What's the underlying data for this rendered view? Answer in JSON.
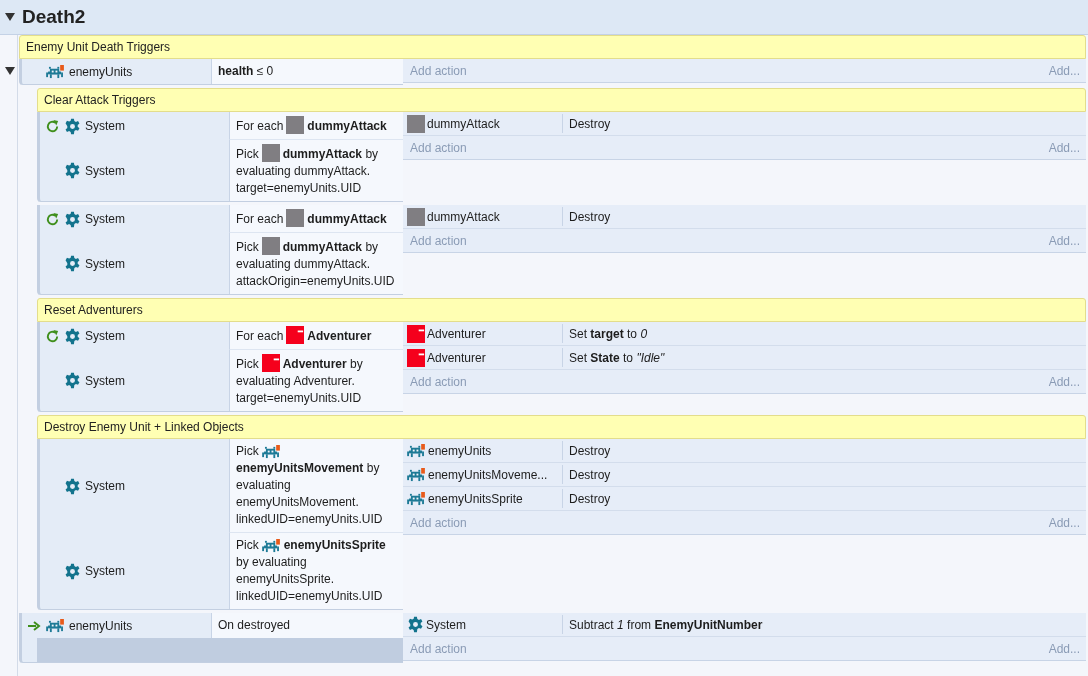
{
  "sheet": {
    "title": "Death2",
    "expanded": true
  },
  "items": [
    {
      "kind": "group",
      "title": "Enemy Unit Death Triggers",
      "items": [
        {
          "kind": "event",
          "expanded": true,
          "conditions": [
            {
              "loop": false,
              "trigger": false,
              "object": {
                "kind": "invader",
                "name": "enemyUnits"
              },
              "text": "**health** ≤ 0"
            }
          ],
          "add_action": "Add action",
          "add_more": "Add...",
          "children": [
            {
              "kind": "group",
              "title": "Clear Attack Triggers",
              "items": [
                {
                  "kind": "event",
                  "conditions": [
                    {
                      "loop": true,
                      "trigger": false,
                      "object": {
                        "kind": "system",
                        "name": "System"
                      },
                      "lead": "For each",
                      "target": {
                        "kind": "plain",
                        "name": "dummyAttack"
                      }
                    },
                    {
                      "loop": false,
                      "trigger": false,
                      "object": {
                        "kind": "system",
                        "name": "System"
                      },
                      "lead": "Pick",
                      "target": {
                        "kind": "plain",
                        "name": "dummyAttack"
                      },
                      "text": "by evaluating dummyAttack.target=enemyUnits.UID"
                    }
                  ],
                  "actions": [
                    {
                      "object": {
                        "kind": "plain",
                        "name": "dummyAttack"
                      },
                      "text": "Destroy"
                    }
                  ],
                  "add_action": "Add action",
                  "add_more": "Add..."
                },
                {
                  "kind": "event",
                  "conditions": [
                    {
                      "loop": true,
                      "trigger": false,
                      "object": {
                        "kind": "system",
                        "name": "System"
                      },
                      "lead": "For each",
                      "target": {
                        "kind": "plain",
                        "name": "dummyAttack"
                      }
                    },
                    {
                      "loop": false,
                      "trigger": false,
                      "object": {
                        "kind": "system",
                        "name": "System"
                      },
                      "lead": "Pick",
                      "target": {
                        "kind": "plain",
                        "name": "dummyAttack"
                      },
                      "text": "by evaluating dummyAttack.attackOrigin=enemyUnits.UID"
                    }
                  ],
                  "actions": [
                    {
                      "object": {
                        "kind": "plain",
                        "name": "dummyAttack"
                      },
                      "text": "Destroy"
                    }
                  ],
                  "add_action": "Add action",
                  "add_more": "Add..."
                }
              ]
            },
            {
              "kind": "group",
              "title": "Reset Adventurers",
              "items": [
                {
                  "kind": "event",
                  "conditions": [
                    {
                      "loop": true,
                      "trigger": false,
                      "object": {
                        "kind": "system",
                        "name": "System"
                      },
                      "lead": "For each",
                      "target": {
                        "kind": "flagged",
                        "name": "Adventurer"
                      }
                    },
                    {
                      "loop": false,
                      "trigger": false,
                      "object": {
                        "kind": "system",
                        "name": "System"
                      },
                      "lead": "Pick",
                      "target": {
                        "kind": "flagged",
                        "name": "Adventurer"
                      },
                      "text": "by evaluating Adventurer.target=enemyUnits.UID"
                    }
                  ],
                  "actions": [
                    {
                      "object": {
                        "kind": "flagged",
                        "name": "Adventurer"
                      },
                      "text": "Set **target** to *0*"
                    },
                    {
                      "object": {
                        "kind": "flagged",
                        "name": "Adventurer"
                      },
                      "text": "Set **State** to *\"Idle\"*"
                    }
                  ],
                  "add_action": "Add action",
                  "add_more": "Add..."
                }
              ]
            },
            {
              "kind": "group",
              "title": "Destroy Enemy Unit + Linked Objects",
              "items": [
                {
                  "kind": "event",
                  "conditions": [
                    {
                      "loop": false,
                      "trigger": false,
                      "object": {
                        "kind": "system",
                        "name": "System"
                      },
                      "lead": "Pick",
                      "target": {
                        "kind": "invader",
                        "name": "enemyUnitsMovement"
                      },
                      "text": "by evaluating enemyUnitsMovement.linkedUID=enemyUnits.UID"
                    },
                    {
                      "loop": false,
                      "trigger": false,
                      "object": {
                        "kind": "system",
                        "name": "System"
                      },
                      "lead": "Pick",
                      "target": {
                        "kind": "invader",
                        "name": "enemyUnitsSprite"
                      },
                      "text": "by evaluating enemyUnitsSprite.linkedUID=enemyUnits.UID"
                    }
                  ],
                  "actions": [
                    {
                      "object": {
                        "kind": "invader",
                        "name": "enemyUnits"
                      },
                      "text": "Destroy"
                    },
                    {
                      "object": {
                        "kind": "invader",
                        "name": "enemyUnitsMoveme..."
                      },
                      "text": "Destroy"
                    },
                    {
                      "object": {
                        "kind": "invader",
                        "name": "enemyUnitsSprite"
                      },
                      "text": "Destroy"
                    }
                  ],
                  "add_action": "Add action",
                  "add_more": "Add..."
                }
              ]
            }
          ]
        },
        {
          "kind": "event",
          "conditions": [
            {
              "loop": false,
              "trigger": true,
              "object": {
                "kind": "invader",
                "name": "enemyUnits"
              },
              "text": "On destroyed"
            }
          ],
          "actions": [
            {
              "object": {
                "kind": "system",
                "name": "System"
              },
              "text": "Subtract *1* from **EnemyUnitNumber**"
            }
          ],
          "add_action": "Add action",
          "add_more": "Add..."
        }
      ]
    }
  ]
}
